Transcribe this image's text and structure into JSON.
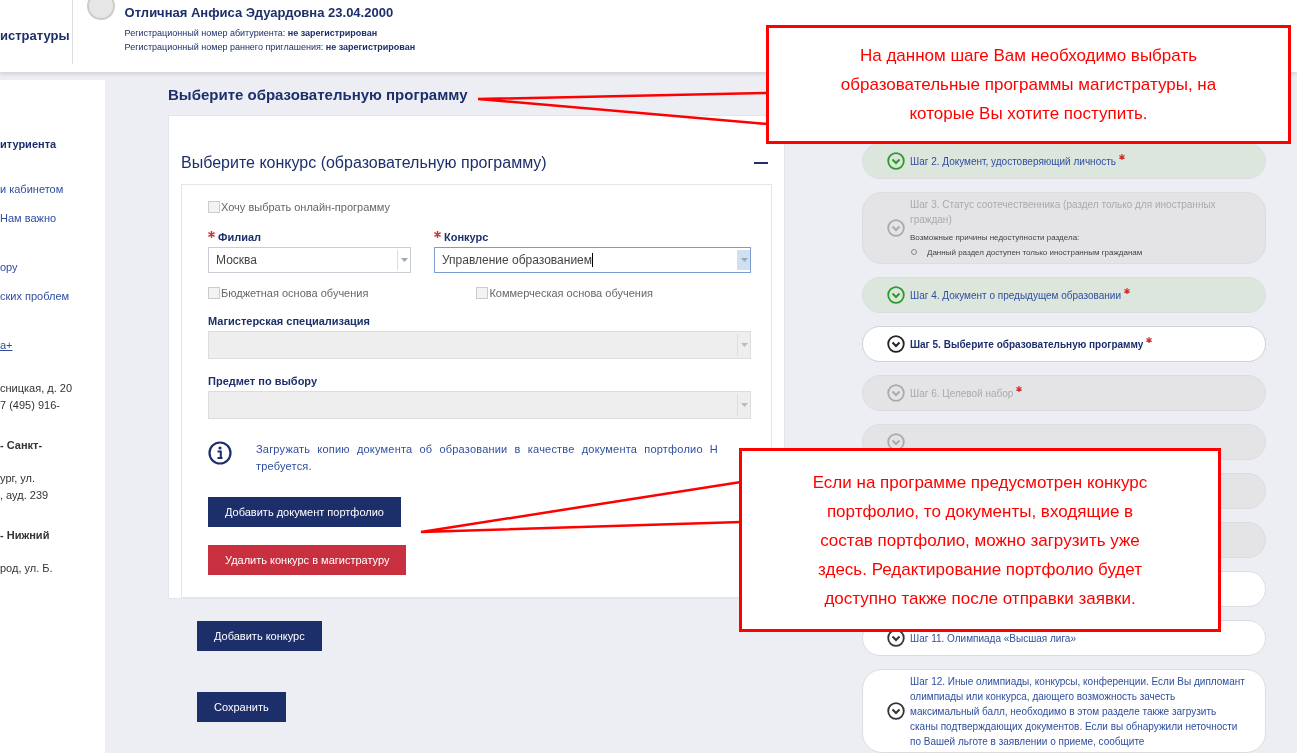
{
  "header": {
    "brand": "истратуры",
    "name": "Отличная Анфиса Эдуардовна 23.04.2000",
    "registration": [
      {
        "label": "Регистрационный номер абитуриента:",
        "value": "не зарегистрирован"
      },
      {
        "label": "Регистрационный номер раннего приглашения:",
        "value": "не зарегистрирован"
      }
    ]
  },
  "sidebar": {
    "groups": [
      {
        "items": [
          {
            "kind": "heading",
            "text": "итуриента"
          }
        ]
      },
      {
        "items": [
          {
            "kind": "link",
            "text": "и кабинетом"
          },
          {
            "kind": "link",
            "text": "Нам важно"
          }
        ]
      },
      {
        "items": [
          {
            "kind": "link",
            "text": "ору"
          },
          {
            "kind": "link",
            "text": "ских проблем"
          }
        ]
      },
      {
        "items": [
          {
            "kind": "underlined",
            "text": "а+"
          }
        ]
      },
      {
        "items": [
          {
            "kind": "text",
            "text": "сницкая, д. 20"
          },
          {
            "kind": "text",
            "text": "7 (495) 916-"
          }
        ]
      },
      {
        "items": [
          {
            "kind": "bold",
            "text": "- Санкт-"
          },
          {
            "kind": "text",
            "text": "ург, ул."
          },
          {
            "kind": "text",
            "text": ", ауд. 239"
          }
        ]
      },
      {
        "items": [
          {
            "kind": "bold",
            "text": "- Нижний"
          },
          {
            "kind": "text",
            "text": "род, ул. Б."
          }
        ]
      }
    ]
  },
  "main": {
    "title": "Выберите образовательную программу",
    "card": {
      "title": "Выберите конкурс (образовательную программу)",
      "expanded": true,
      "online_checkbox": {
        "label": "Хочу выбрать онлайн-программу",
        "checked": false
      },
      "selects": [
        {
          "label": "Филиал",
          "required": true,
          "value": "Москва",
          "focused": false
        },
        {
          "label": "Конкурс",
          "required": true,
          "value": "Управление образованием",
          "focused": true
        }
      ],
      "basis_checkboxes": [
        {
          "label": "Бюджетная основа обучения",
          "checked": false
        },
        {
          "label": "Коммерческая основа обучения",
          "checked": false
        }
      ],
      "disabled_selects": [
        {
          "label": "Магистерская специализация"
        },
        {
          "label": "Предмет по выбору"
        }
      ],
      "info": "Загружать копию документа об образовании в качестве документа портфолио Н требуется.",
      "buttons": [
        {
          "label": "Добавить документ портфолио",
          "kind": "primary"
        },
        {
          "label": "Удалить конкурс в магистратуру",
          "kind": "danger"
        }
      ]
    },
    "buttons": [
      {
        "label": "Добавить конкурс"
      },
      {
        "label": "Сохранить"
      }
    ]
  },
  "steps": [
    {
      "completed": true,
      "disabled": false,
      "selected": false,
      "label": "Шаг 2. Документ, удостоверяющий личность",
      "required": true
    },
    {
      "completed": false,
      "disabled": true,
      "selected": false,
      "label": "Шаг 3. Статус соотечественника (раздел только для иностранных граждан)",
      "required": false,
      "note": "Возможные причины недоступности раздела:",
      "reasons": [
        "Данный раздел доступен только иностранным гражданам"
      ]
    },
    {
      "completed": true,
      "disabled": false,
      "selected": false,
      "label": "Шаг 4. Документ о предыдущем образовании",
      "required": true
    },
    {
      "completed": false,
      "disabled": false,
      "selected": true,
      "label": "Шаг 5. Выберите образовательную программу",
      "required": true
    },
    {
      "completed": false,
      "disabled": true,
      "selected": false,
      "label": "Шаг 6. Целевой набор",
      "required": true
    },
    {
      "completed": false,
      "disabled": true,
      "selected": false
    },
    {
      "completed": false,
      "disabled": true,
      "selected": false
    },
    {
      "completed": false,
      "disabled": true,
      "selected": false
    },
    {
      "completed": false,
      "disabled": false,
      "selected": false
    },
    {
      "completed": false,
      "disabled": false,
      "selected": false,
      "label": "Шаг 11. Олимпиада «Высшая лига»",
      "required": false
    },
    {
      "completed": false,
      "disabled": false,
      "selected": false,
      "label": "Шаг 12. Иные олимпиады, конкурсы, конференции. Если Вы дипломант олимпиады или конкурса, дающего возможность зачесть максимальный балл, необходимо в этом разделе также загрузить сканы подтверждающих документов. Если вы обнаружили неточности по Вашей льготе в заявлении о приеме, сообщите",
      "required": false
    }
  ],
  "callouts": [
    {
      "text": "На данном шаге Вам необходимо выбрать образовательные программы магистратуры, на которые Вы хотите поступить."
    },
    {
      "text": "Если на программе предусмотрен конкурс портфолио, то документы, входящие в состав портфолио, можно загрузить уже здесь. Редактирование портфолио будет доступно также после отправки заявки."
    }
  ]
}
